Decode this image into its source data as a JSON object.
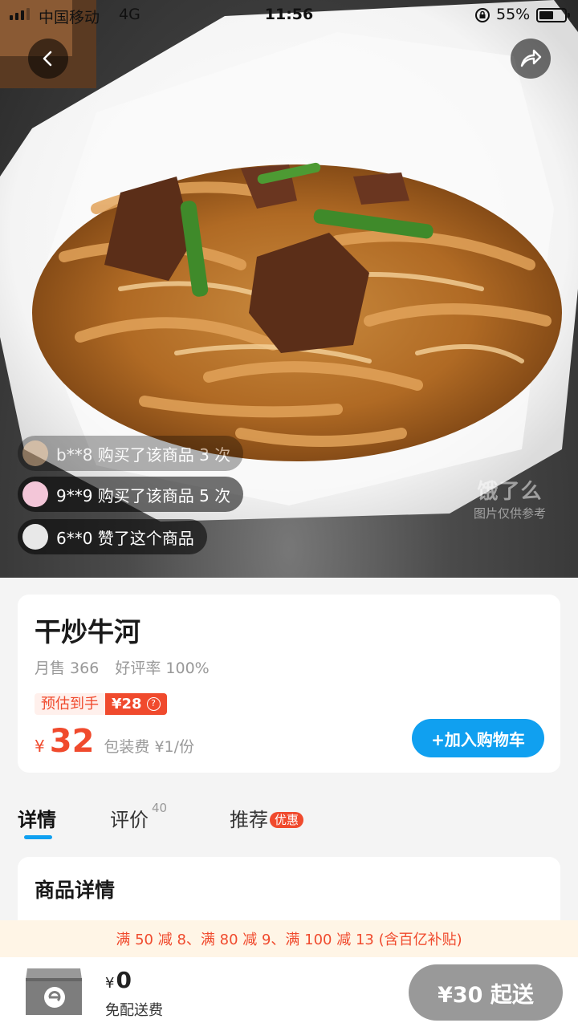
{
  "status_bar": {
    "carrier": "中国移动",
    "network": "4G",
    "time": "11:56",
    "battery_percent": "55%"
  },
  "hero": {
    "back_icon": "chevron-left-icon",
    "share_icon": "share-arrow-icon",
    "buyer_feed": [
      {
        "text": "b**8 购买了该商品 3 次"
      },
      {
        "text": "9**9 购买了该商品 5 次"
      },
      {
        "text": "6**0 赞了这个商品"
      }
    ],
    "watermark_logo": "饿了么",
    "watermark_note": "图片仅供参考"
  },
  "product": {
    "name": "干炒牛河",
    "monthly_sales": "月售 366",
    "rating": "好评率 100%",
    "estimate_label": "预估到手",
    "estimate_price": "¥28",
    "currency": "¥",
    "price": "32",
    "packaging_fee": "包装费 ¥1/份",
    "add_to_cart": "+加入购物车"
  },
  "tabs": [
    {
      "label": "详情",
      "active": true
    },
    {
      "label": "评价",
      "count": "40"
    },
    {
      "label": "推荐",
      "badge": "优惠"
    }
  ],
  "details": {
    "title": "商品详情"
  },
  "promo_bar": {
    "text": "满 50 减 8、满 80 减 9、满 100 减 13 (含百亿补贴)"
  },
  "bottom_bar": {
    "cart_currency": "¥",
    "cart_total": "0",
    "delivery_fee": "免配送费",
    "checkout_label": "¥30 起送"
  },
  "colors": {
    "accent_blue": "#10a0f0",
    "price_red": "#f04a2d",
    "checkout_disabled": "#999999"
  }
}
